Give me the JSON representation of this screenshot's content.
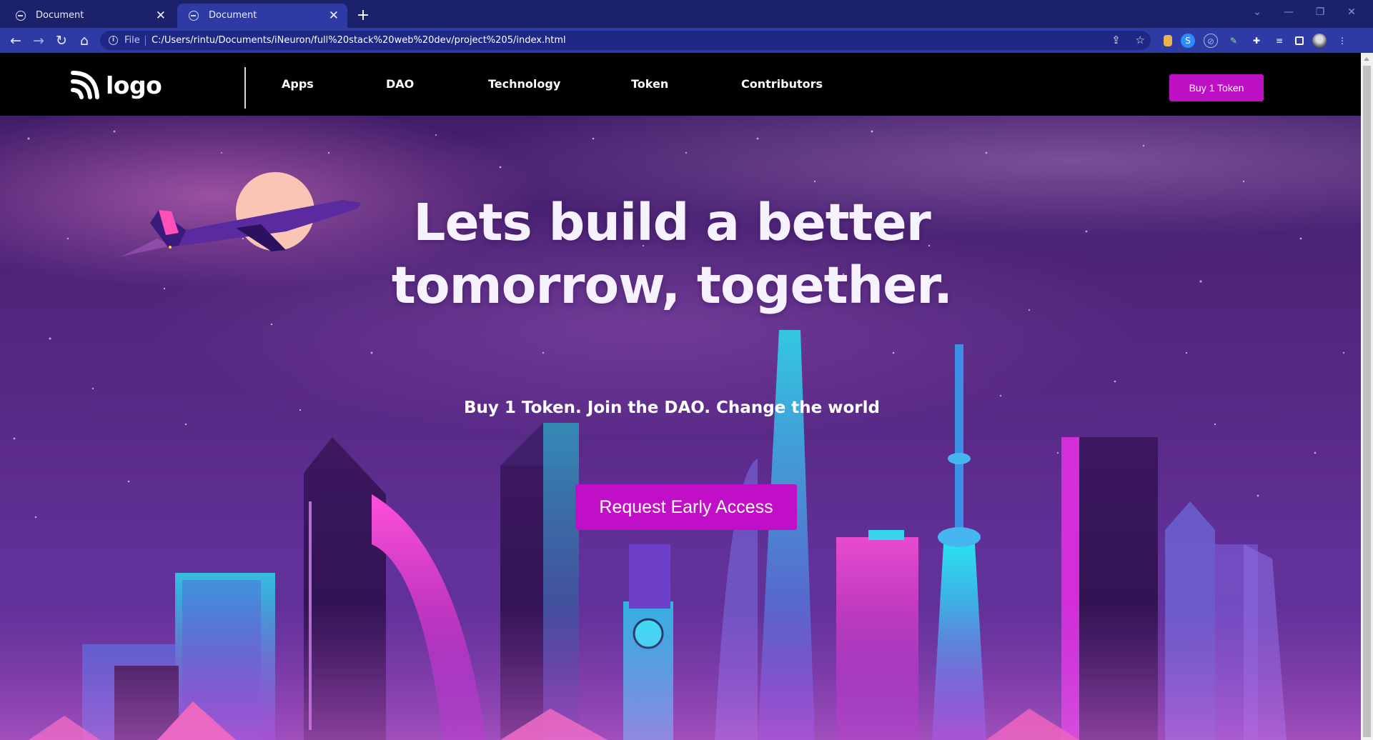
{
  "browser": {
    "tabs": [
      {
        "title": "Document",
        "active": false
      },
      {
        "title": "Document",
        "active": true
      }
    ],
    "new_tab_symbol": "+",
    "tab_close_symbol": "✕",
    "address": {
      "scheme": "File",
      "url": "C:/Users/rintu/Documents/iNeuron/full%20stack%20web%20dev/project%205/index.html"
    },
    "nav_icons": [
      "back-arrow-icon",
      "forward-arrow-icon",
      "reload-icon",
      "home-icon"
    ],
    "window_controls": [
      "chevron-down-icon",
      "minimize-icon",
      "restore-icon",
      "close-icon"
    ]
  },
  "site": {
    "logo_text": "logo",
    "nav": [
      {
        "label": "Apps"
      },
      {
        "label": "DAO"
      },
      {
        "label": "Technology"
      },
      {
        "label": "Token"
      },
      {
        "label": "Contributors"
      }
    ],
    "header_button": "Buy 1 Token",
    "hero": {
      "title_line1": "Lets build a better",
      "title_line2": "tomorrow, together.",
      "subtitle": "Buy 1 Token. Join the DAO. Change the world",
      "cta": "Request Early Access"
    }
  },
  "colors": {
    "browser_frame": "#1b226b",
    "browser_toolbar": "#2e3ba5",
    "header_bg": "#000000",
    "accent": "#bd10c4",
    "hero_text": "#f7f2ff"
  }
}
